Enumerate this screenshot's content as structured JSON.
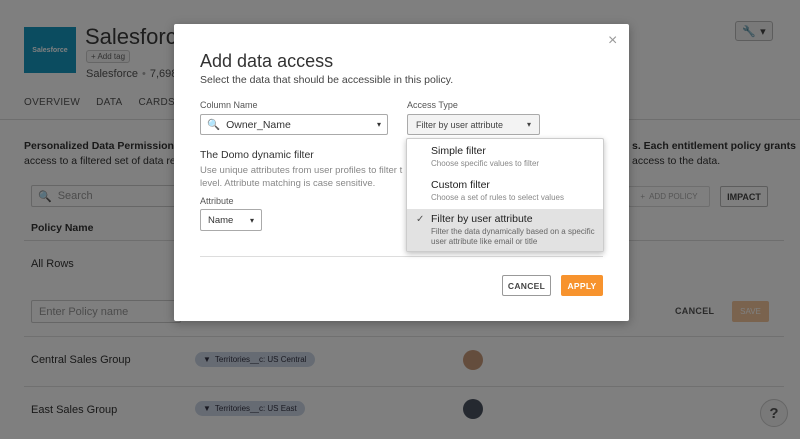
{
  "header": {
    "logo_text": "Salesforce",
    "title": "Salesforce",
    "add_tag": "+ Add tag",
    "meta_source": "Salesforce",
    "meta_rows": "7,698 ro",
    "menu_icon": "wrench-icon"
  },
  "tabs": [
    "OVERVIEW",
    "DATA",
    "CARDS",
    "D"
  ],
  "description": {
    "bold": "Personalized Data Permissions",
    "text_left": " al",
    "line2": "access to a filtered set of data repre",
    "right_line1": "s. Each entitlement policy grants",
    "right_line2": "access to the data."
  },
  "toolbar": {
    "search_placeholder": "Search",
    "add_policy": "ADD POLICY",
    "impact": "IMPACT"
  },
  "table": {
    "col_policy": "Policy Name",
    "row_all": "All Rows",
    "new_policy_placeholder": "Enter Policy name",
    "cancel": "CANCEL",
    "save": "SAVE",
    "rows": [
      {
        "name": "Central Sales Group",
        "filter": "Territories__c: US Central"
      },
      {
        "name": "East Sales Group",
        "filter": "Territories__c: US East"
      }
    ]
  },
  "help": "?",
  "modal": {
    "title": "Add data access",
    "subtitle": "Select the data that should be accessible in this policy.",
    "column_name_label": "Column Name",
    "column_name_value": "Owner_Name",
    "access_type_label": "Access Type",
    "access_type_value": "Filter by user attribute",
    "dynamic_title": "The Domo dynamic filter",
    "dynamic_desc_1": "Use unique attributes from user profiles to filter t",
    "dynamic_desc_2": "level. Attribute matching is case sensitive.",
    "attribute_label": "Attribute",
    "attribute_value": "Name",
    "cancel": "CANCEL",
    "apply": "APPLY",
    "close": "×"
  },
  "dropdown": [
    {
      "title": "Simple filter",
      "desc": "Choose specific values to filter",
      "selected": false
    },
    {
      "title": "Custom filter",
      "desc": "Choose a set of rules to select values",
      "selected": false
    },
    {
      "title": "Filter by user attribute",
      "desc": "Filter the data dynamically based on a specific user attribute like email or title",
      "selected": true
    }
  ],
  "colors": {
    "accent": "#f7932e",
    "logo": "#1798c1",
    "chip": "#cdd7e6"
  }
}
